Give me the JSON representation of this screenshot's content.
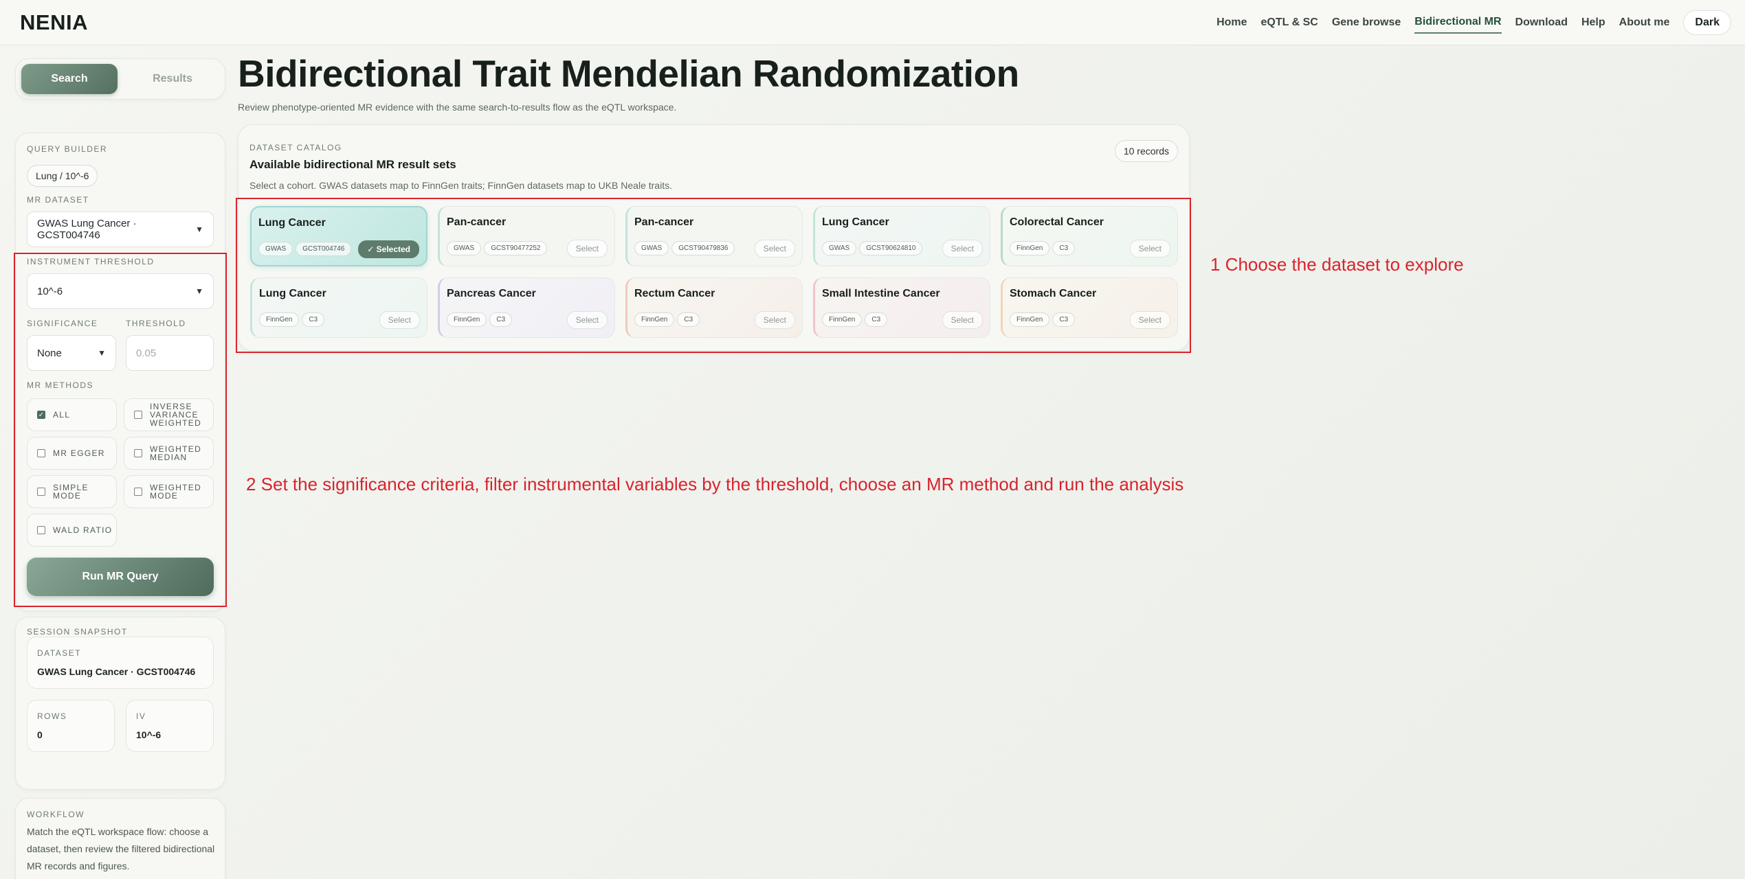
{
  "nav": {
    "brand": "NENIA",
    "items": [
      "Home",
      "eQTL & SC",
      "Gene browse",
      "Bidirectional MR",
      "Download",
      "Help",
      "About me"
    ],
    "active": "Bidirectional MR",
    "theme_toggle": "Dark"
  },
  "tabs": {
    "search": "Search",
    "results": "Results"
  },
  "query_builder": {
    "label": "QUERY BUILDER",
    "chip": "Lung / 10^-6",
    "dataset_label": "MR DATASET",
    "dataset_value": "GWAS Lung Cancer · GCST004746",
    "instrument_label": "INSTRUMENT THRESHOLD",
    "instrument_value": "10^-6",
    "significance_label": "SIGNIFICANCE",
    "significance_value": "None",
    "threshold_label": "THRESHOLD",
    "threshold_placeholder": "0.05",
    "methods_label": "MR METHODS",
    "methods": [
      {
        "label": "ALL",
        "checked": true
      },
      {
        "label": "INVERSE VARIANCE WEIGHTED",
        "checked": false
      },
      {
        "label": "MR EGGER",
        "checked": false
      },
      {
        "label": "WEIGHTED MEDIAN",
        "checked": false
      },
      {
        "label": "SIMPLE MODE",
        "checked": false
      },
      {
        "label": "WEIGHTED MODE",
        "checked": false
      },
      {
        "label": "WALD RATIO",
        "checked": false
      }
    ],
    "run_label": "Run MR Query"
  },
  "snapshot": {
    "label": "SESSION SNAPSHOT",
    "dataset_key": "DATASET",
    "dataset_value": "GWAS Lung Cancer · GCST004746",
    "rows_key": "ROWS",
    "rows_value": "0",
    "iv_key": "IV",
    "iv_value": "10^-6"
  },
  "workflow": {
    "label": "WORKFLOW",
    "text": "Match the eQTL workspace flow: choose a dataset, then review the filtered bidirectional MR records and figures."
  },
  "page": {
    "title": "Bidirectional Trait Mendelian Randomization",
    "subtitle": "Review phenotype-oriented MR evidence with the same search-to-results flow as the eQTL workspace."
  },
  "catalog": {
    "eyebrow": "DATASET CATALOG",
    "title": "Available bidirectional MR result sets",
    "description": "Select a cohort. GWAS datasets map to FinnGen traits; FinnGen datasets map to UKB Neale traits.",
    "count": "10 records",
    "cards": [
      {
        "name": "Lung Cancer",
        "source": "GWAS",
        "id": "GCST004746",
        "action": "✓ Selected"
      },
      {
        "name": "Pan-cancer",
        "source": "GWAS",
        "id": "GCST90477252",
        "action": "Select"
      },
      {
        "name": "Pan-cancer",
        "source": "GWAS",
        "id": "GCST90479836",
        "action": "Select"
      },
      {
        "name": "Lung Cancer",
        "source": "GWAS",
        "id": "GCST90624810",
        "action": "Select"
      },
      {
        "name": "Colorectal Cancer",
        "source": "FinnGen",
        "id": "C3",
        "action": "Select"
      },
      {
        "name": "Lung Cancer",
        "source": "FinnGen",
        "id": "C3",
        "action": "Select"
      },
      {
        "name": "Pancreas Cancer",
        "source": "FinnGen",
        "id": "C3",
        "action": "Select"
      },
      {
        "name": "Rectum Cancer",
        "source": "FinnGen",
        "id": "C3",
        "action": "Select"
      },
      {
        "name": "Small Intestine Cancer",
        "source": "FinnGen",
        "id": "C3",
        "action": "Select"
      },
      {
        "name": "Stomach Cancer",
        "source": "FinnGen",
        "id": "C3",
        "action": "Select"
      }
    ]
  },
  "annotations": {
    "one": "1 Choose the dataset to explore",
    "two": "2 Set the significance criteria, filter instrumental variables by the threshold, choose an MR method and run the analysis"
  },
  "colors": {
    "accent": "#5e7c6c",
    "annotation": "#d9232c"
  }
}
